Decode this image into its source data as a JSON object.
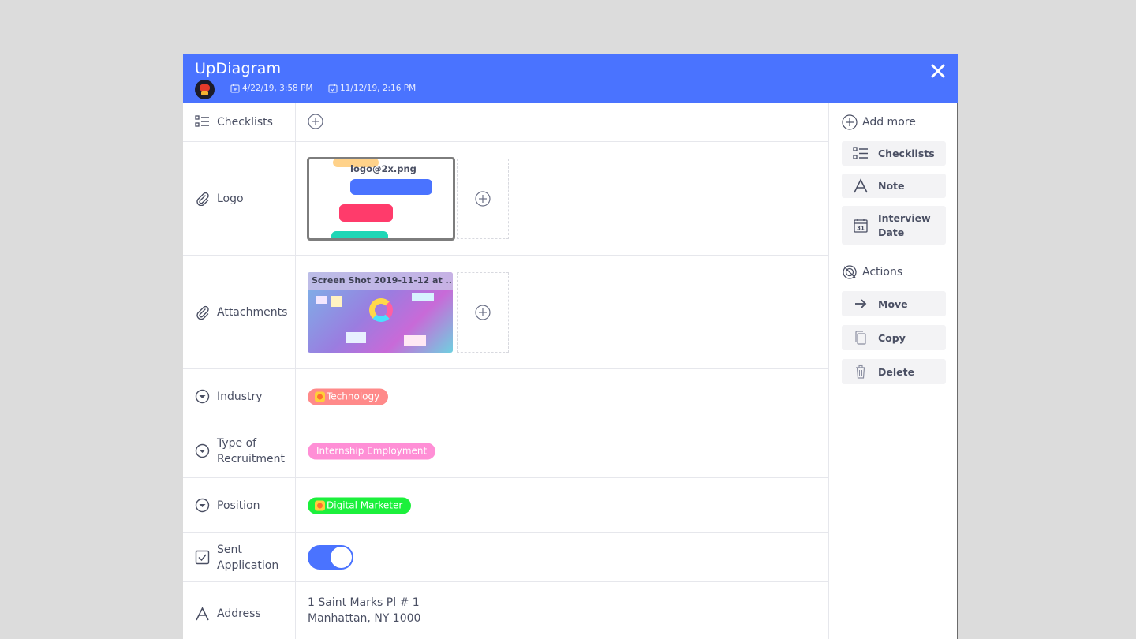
{
  "header": {
    "title": "UpDiagram",
    "created_date": "4/22/19, 3:58 PM",
    "updated_date": "11/12/19, 2:16 PM",
    "bg_color": "#4a73ff",
    "close_icon": "close-icon"
  },
  "rows": {
    "checklists": {
      "label": "Checklists"
    },
    "logo": {
      "label": "Logo",
      "file_name": "logo@2x.png"
    },
    "attachments": {
      "label": "Attachments",
      "file_name": "Screen Shot 2019-11-12 at ..."
    },
    "industry": {
      "label": "Industry",
      "tag": "Technology",
      "tag_color": "#ff8a8a"
    },
    "recruitment": {
      "label_line1": "Type of",
      "label_line2": "Recruitment",
      "tag": "Internship Employment",
      "tag_color": "#ff8fd6"
    },
    "position": {
      "label": "Position",
      "tag": "Digital Marketer",
      "tag_color": "#1cf03c"
    },
    "sent_application": {
      "label_line1": "Sent",
      "label_line2": "Application",
      "toggle_on": true
    },
    "address": {
      "label": "Address",
      "line1": "1 Saint Marks Pl # 1",
      "line2": "Manhattan, NY 1000"
    }
  },
  "sidebar": {
    "add_more_label": "Add more",
    "add_items": [
      {
        "label": "Checklists",
        "icon": "checklist-icon"
      },
      {
        "label": "Note",
        "icon": "text-icon"
      },
      {
        "label_line1": "Interview",
        "label_line2": "Date",
        "icon": "calendar-icon"
      }
    ],
    "actions_label": "Actions",
    "action_items": [
      {
        "label": "Move",
        "icon": "arrow-right-icon"
      },
      {
        "label": "Copy",
        "icon": "copy-icon"
      },
      {
        "label": "Delete",
        "icon": "trash-icon"
      }
    ]
  },
  "colors": {
    "accent": "#4a73ff",
    "text": "#4a4f63"
  }
}
